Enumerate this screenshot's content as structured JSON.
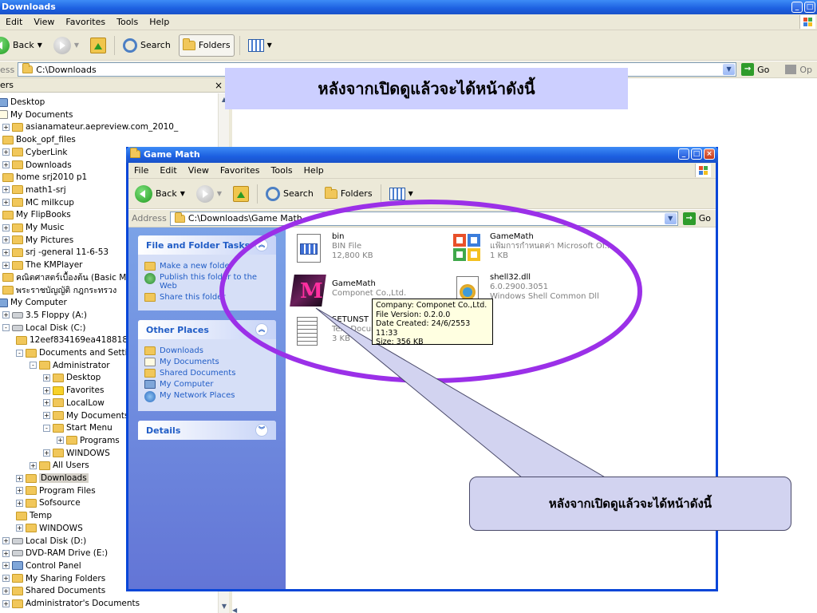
{
  "outer": {
    "title": "Downloads",
    "menu": [
      "Edit",
      "View",
      "Favorites",
      "Tools",
      "Help"
    ],
    "toolbar": {
      "back": "Back",
      "search": "Search",
      "folders": "Folders"
    },
    "address_label": "ess",
    "address_value": "C:\\Downloads",
    "go": "Go",
    "extra": "Op",
    "tree_header": "ers",
    "tree": [
      {
        "label": "Desktop",
        "indent": 0,
        "icon": "desktop",
        "pm": ""
      },
      {
        "label": "My Documents",
        "indent": 0,
        "icon": "doc",
        "pm": ""
      },
      {
        "label": "asianamateur.aepreview.com_2010_",
        "indent": 1,
        "icon": "folder",
        "pm": "+"
      },
      {
        "label": "Book_opf_files",
        "indent": 1,
        "icon": "folder",
        "pm": ""
      },
      {
        "label": "CyberLink",
        "indent": 1,
        "icon": "folder",
        "pm": "+"
      },
      {
        "label": "Downloads",
        "indent": 1,
        "icon": "folder",
        "pm": "+"
      },
      {
        "label": "home srj2010 p1",
        "indent": 1,
        "icon": "folder",
        "pm": ""
      },
      {
        "label": "math1-srj",
        "indent": 1,
        "icon": "folder",
        "pm": "+"
      },
      {
        "label": "MC milkcup",
        "indent": 1,
        "icon": "folder",
        "pm": "+"
      },
      {
        "label": "My FlipBooks",
        "indent": 1,
        "icon": "folder",
        "pm": ""
      },
      {
        "label": "My Music",
        "indent": 1,
        "icon": "music",
        "pm": "+"
      },
      {
        "label": "My Pictures",
        "indent": 1,
        "icon": "folder",
        "pm": "+"
      },
      {
        "label": "srj -general 11-6-53",
        "indent": 1,
        "icon": "folder",
        "pm": "+"
      },
      {
        "label": "The KMPlayer",
        "indent": 1,
        "icon": "folder",
        "pm": "+"
      },
      {
        "label": "คณิตศาสตร์เบื้องต้น (Basic M",
        "indent": 1,
        "icon": "folder",
        "pm": ""
      },
      {
        "label": "พระราชบัญญัติ กฎกระทรวง",
        "indent": 1,
        "icon": "folder",
        "pm": ""
      },
      {
        "label": "My Computer",
        "indent": 0,
        "icon": "comp",
        "pm": ""
      },
      {
        "label": "3.5 Floppy (A:)",
        "indent": 1,
        "icon": "drive",
        "pm": "+"
      },
      {
        "label": "Local Disk (C:)",
        "indent": 1,
        "icon": "drive",
        "pm": "-"
      },
      {
        "label": "12eef834169ea4188186",
        "indent": 2,
        "icon": "folder",
        "pm": ""
      },
      {
        "label": "Documents and Settings",
        "indent": 2,
        "icon": "folder",
        "pm": "-"
      },
      {
        "label": "Administrator",
        "indent": 3,
        "icon": "folder",
        "pm": "-"
      },
      {
        "label": "Desktop",
        "indent": 4,
        "icon": "folder",
        "pm": "+"
      },
      {
        "label": "Favorites",
        "indent": 4,
        "icon": "star",
        "pm": "+"
      },
      {
        "label": "LocalLow",
        "indent": 4,
        "icon": "folder",
        "pm": "+"
      },
      {
        "label": "My Documents",
        "indent": 4,
        "icon": "folder",
        "pm": "+"
      },
      {
        "label": "Start Menu",
        "indent": 4,
        "icon": "folder",
        "pm": "-"
      },
      {
        "label": "Programs",
        "indent": 5,
        "icon": "folder",
        "pm": "+"
      },
      {
        "label": "WINDOWS",
        "indent": 4,
        "icon": "folder",
        "pm": "+"
      },
      {
        "label": "All Users",
        "indent": 3,
        "icon": "folder",
        "pm": "+"
      },
      {
        "label": "Downloads",
        "indent": 2,
        "icon": "folder",
        "pm": "+",
        "selected": true
      },
      {
        "label": "Program Files",
        "indent": 2,
        "icon": "folder",
        "pm": "+"
      },
      {
        "label": "Sofsource",
        "indent": 2,
        "icon": "folder",
        "pm": "+"
      },
      {
        "label": "Temp",
        "indent": 2,
        "icon": "folder",
        "pm": ""
      },
      {
        "label": "WINDOWS",
        "indent": 2,
        "icon": "folder",
        "pm": "+"
      },
      {
        "label": "Local Disk (D:)",
        "indent": 1,
        "icon": "drive",
        "pm": "+"
      },
      {
        "label": "DVD-RAM Drive (E:)",
        "indent": 1,
        "icon": "drive",
        "pm": "+"
      },
      {
        "label": "Control Panel",
        "indent": 1,
        "icon": "comp",
        "pm": "+"
      },
      {
        "label": "My Sharing Folders",
        "indent": 1,
        "icon": "folder",
        "pm": "+"
      },
      {
        "label": "Shared Documents",
        "indent": 1,
        "icon": "folder",
        "pm": "+"
      },
      {
        "label": "Administrator's Documents",
        "indent": 1,
        "icon": "folder",
        "pm": "+"
      }
    ]
  },
  "banner": "หลังจากเปิดดูแล้วจะได้หน้าดังนี้",
  "inner": {
    "title": "Game Math",
    "menu": [
      "File",
      "Edit",
      "View",
      "Favorites",
      "Tools",
      "Help"
    ],
    "toolbar": {
      "back": "Back",
      "search": "Search",
      "folders": "Folders"
    },
    "address_label": "Address",
    "address_value": "C:\\Downloads\\Game Math",
    "go": "Go",
    "tasks": {
      "title": "File and Folder Tasks",
      "links": [
        "Make a new folder",
        "Publish this folder to the Web",
        "Share this folder"
      ]
    },
    "places": {
      "title": "Other Places",
      "links": [
        "Downloads",
        "My Documents",
        "Shared Documents",
        "My Computer",
        "My Network Places"
      ]
    },
    "details": {
      "title": "Details"
    },
    "files": [
      {
        "name": "bin",
        "type": "BIN File",
        "size": "12,800 KB",
        "icon": "bin-file-icon"
      },
      {
        "name": "GameMath",
        "type": "แฟ้มการกำหนดค่า Microsoft Of...",
        "size": "1 KB",
        "icon": "office-config-icon"
      },
      {
        "name": "GameMath",
        "type": "Componet Co.,Ltd.",
        "size": "",
        "icon": "gamemath-app-icon"
      },
      {
        "name": "shell32.dll",
        "type": "6.0.2900.3051",
        "size": "Windows Shell Common Dll",
        "icon": "dll-file-icon"
      },
      {
        "name": "SETUNST",
        "type": "Text Docum",
        "size": "3 KB",
        "icon": "text-document-icon"
      }
    ],
    "tooltip": [
      "Company: Componet Co.,Ltd.",
      "File Version: 0.2.0.0",
      "Date Created: 24/6/2553 11:33",
      "Size: 356 KB"
    ]
  },
  "callout": "หลังจากเปิดดูแล้วจะได้หน้าดังนี้",
  "colors": {
    "title_bar": "#1c5fe0",
    "task_pane": "#6375d6",
    "ellipse": "#9b30e8",
    "banner_bg": "#cccfff",
    "callout_bg": "#d2d3f0"
  }
}
